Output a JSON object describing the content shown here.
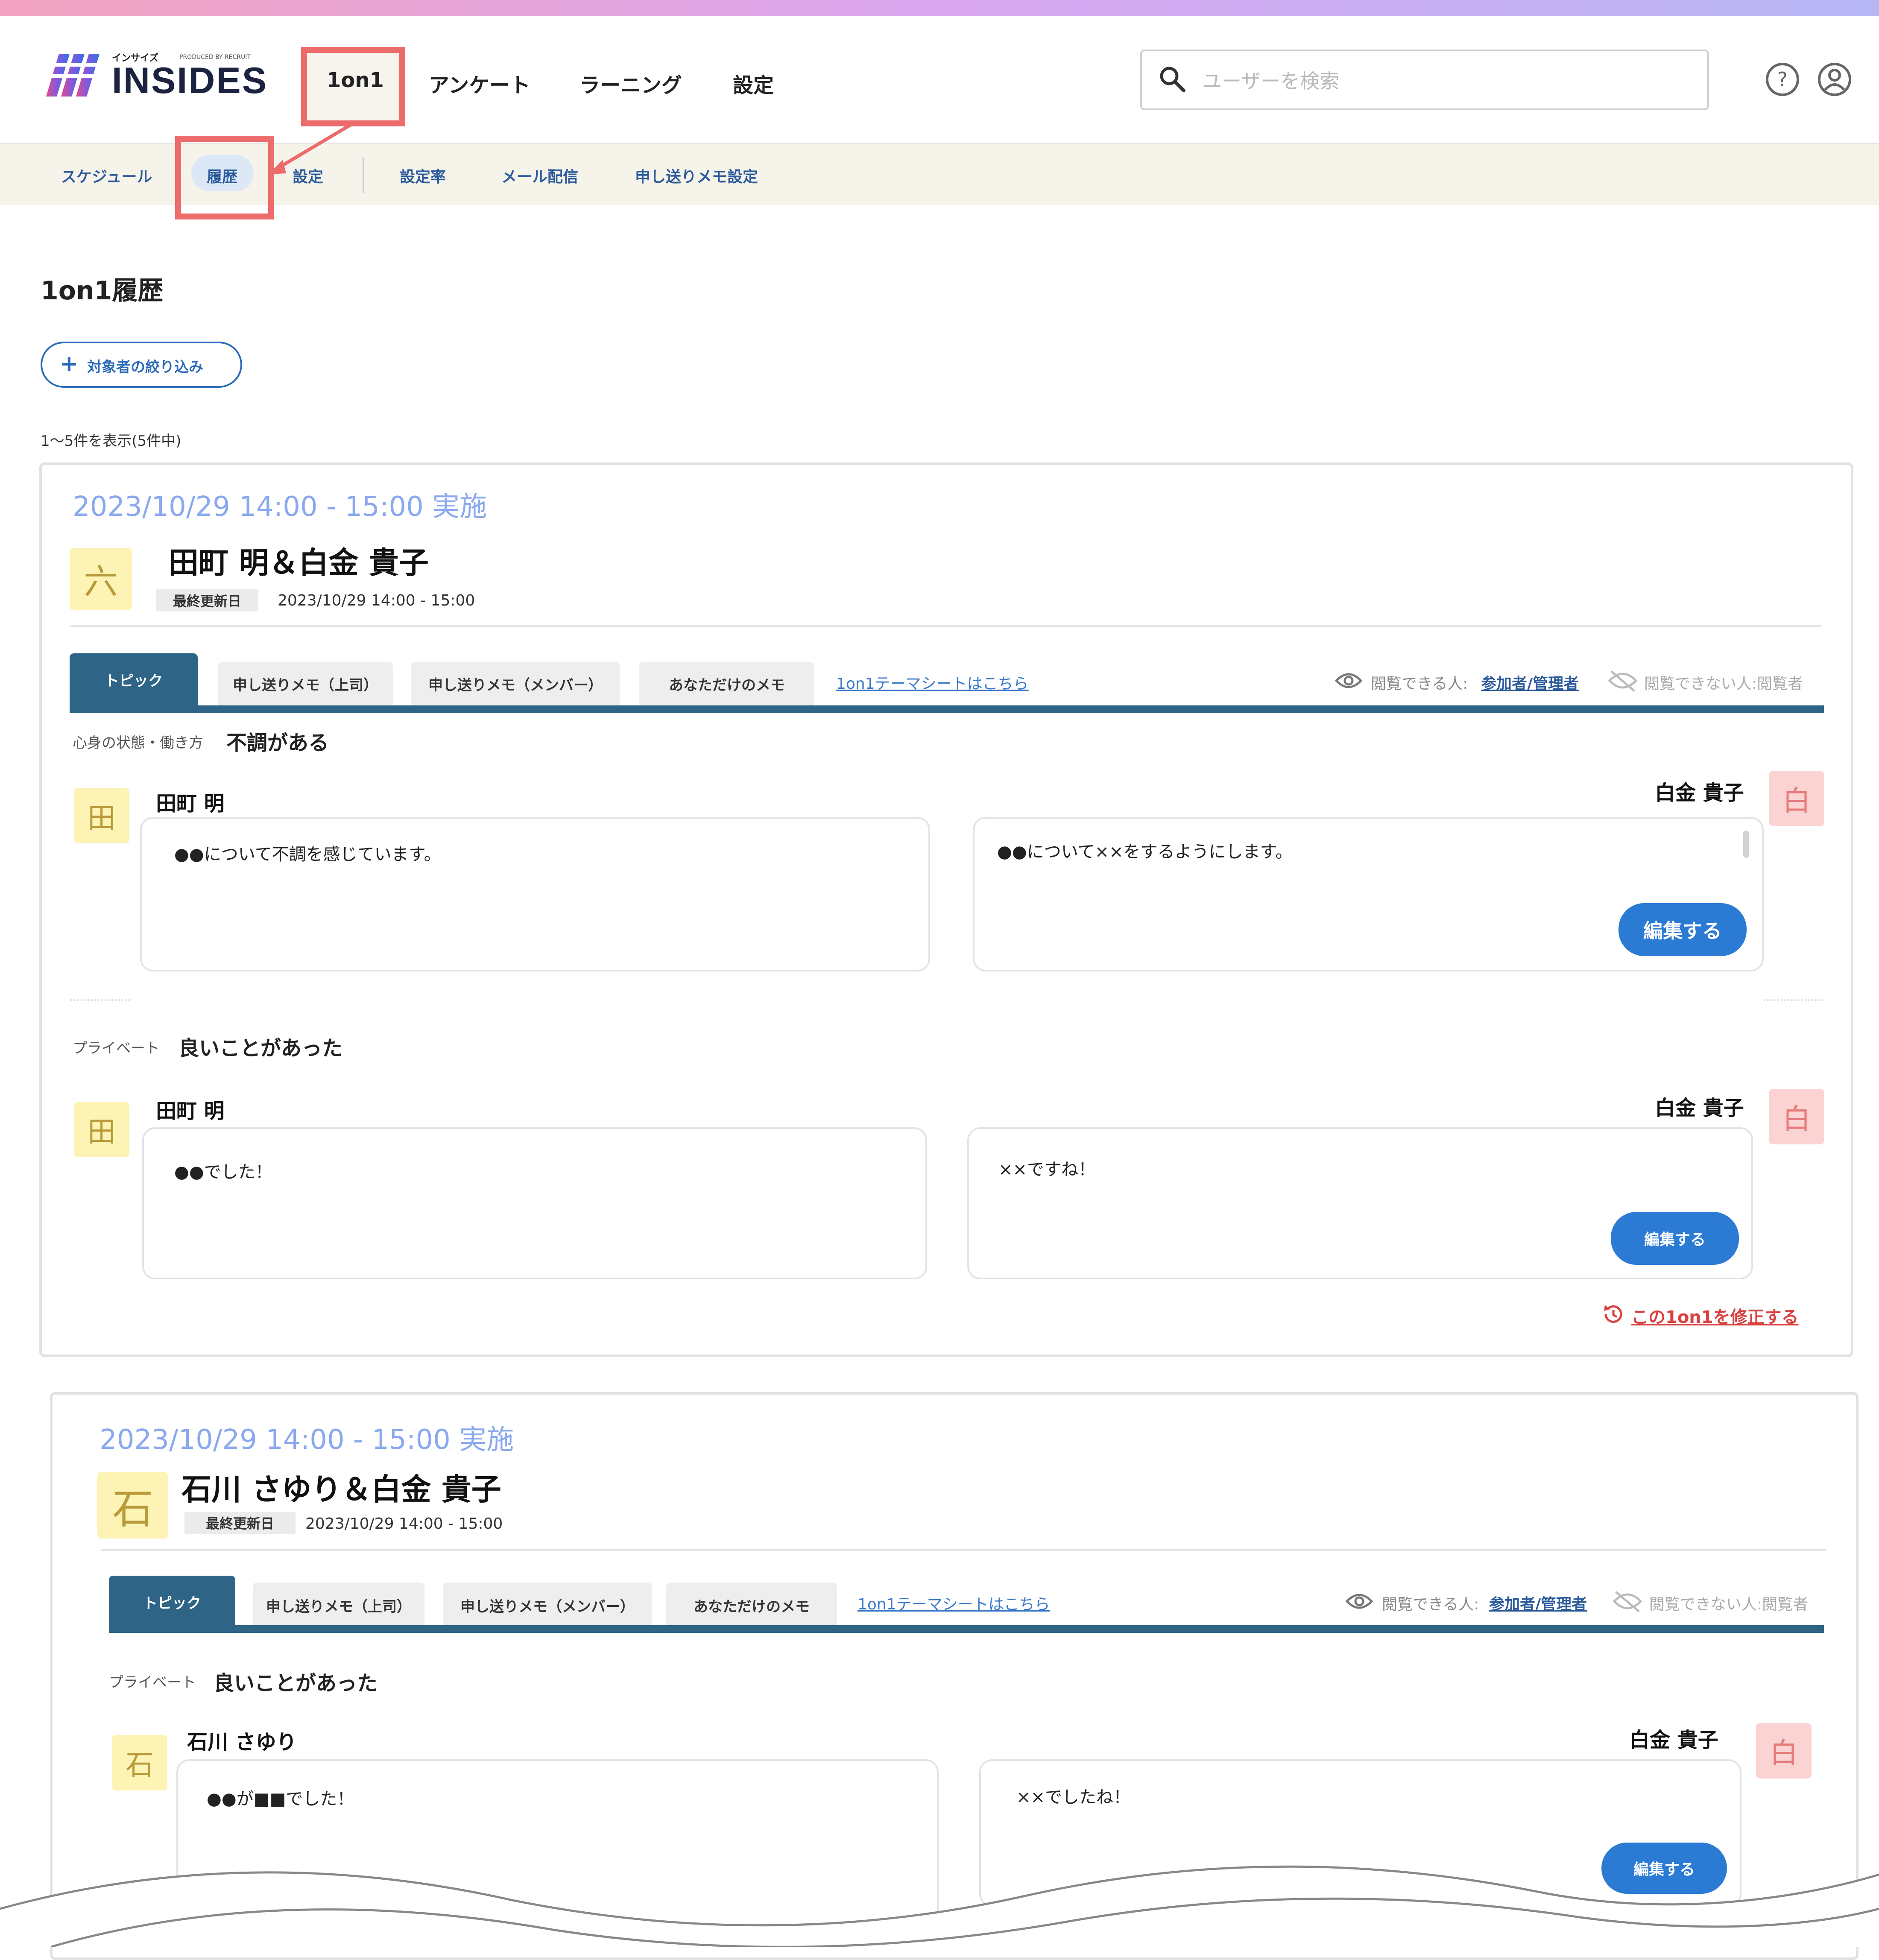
{
  "header": {
    "logo_small": "インサイズ",
    "logo_produced": "PRODUCED BY RECRUIT",
    "logo_text": "INSIDES",
    "nav": [
      "1on1",
      "アンケート",
      "ラーニング",
      "設定"
    ],
    "search_placeholder": "ユーザーを検索"
  },
  "subnav": {
    "items": [
      "スケジュール",
      "履歴",
      "設定",
      "設定率",
      "メール配信",
      "申し送りメモ設定"
    ],
    "active": "履歴"
  },
  "page": {
    "title": "1on1履歴",
    "filter_label": "対象者の絞り込み",
    "count": "1〜5件を表示(5件中)"
  },
  "colors": {
    "accent": "#2e6485",
    "button": "#2b7bd4",
    "highlight": "#ec6b6b",
    "date": "#8aa8ee"
  },
  "cards": [
    {
      "date": "2023/10/29  14:00 - 15:00 実施",
      "avatar": "六",
      "names": "田町 明＆白金 貴子",
      "updated_label": "最終更新日",
      "updated_date": "2023/10/29  14:00 - 15:00",
      "tabs": [
        "トピック",
        "申し送りメモ（上司）",
        "申し送りメモ（メンバー）",
        "あなただけのメモ"
      ],
      "theme_link": "1on1テーマシートはこちら",
      "perm_label": "閲覧できる人:",
      "perm_value": "参加者/管理者",
      "perm_no": "閲覧できない人:閲覧者",
      "topics": [
        {
          "label": "心身の状態・働き方",
          "value": "不調がある",
          "left_avatar": "田",
          "left_name": "田町 明",
          "left_text": "●●について不調を感じています。",
          "right_avatar": "白",
          "right_name": "白金 貴子",
          "right_text": "●●について××をするようにします。",
          "edit": "編集する"
        },
        {
          "label": "プライベート",
          "value": "良いことがあった",
          "left_avatar": "田",
          "left_name": "田町 明",
          "left_text": "●●でした！",
          "right_avatar": "白",
          "right_name": "白金 貴子",
          "right_text": "××ですね！",
          "edit": "編集する"
        }
      ],
      "fix_link": "この1on1を修正する"
    },
    {
      "date": "2023/10/29  14:00 - 15:00 実施",
      "avatar": "石",
      "names": "石川 さゆり＆白金 貴子",
      "updated_label": "最終更新日",
      "updated_date": "2023/10/29  14:00 - 15:00",
      "tabs": [
        "トピック",
        "申し送りメモ（上司）",
        "申し送りメモ（メンバー）",
        "あなただけのメモ"
      ],
      "theme_link": "1on1テーマシートはこちら",
      "perm_label": "閲覧できる人:",
      "perm_value": "参加者/管理者",
      "perm_no": "閲覧できない人:閲覧者",
      "topics": [
        {
          "label": "プライベート",
          "value": "良いことがあった",
          "left_avatar": "石",
          "left_name": "石川 さゆり",
          "left_text": "●●が■■でした！",
          "right_avatar": "白",
          "right_name": "白金 貴子",
          "right_text": "××でしたね！",
          "edit": "編集する"
        }
      ]
    }
  ]
}
